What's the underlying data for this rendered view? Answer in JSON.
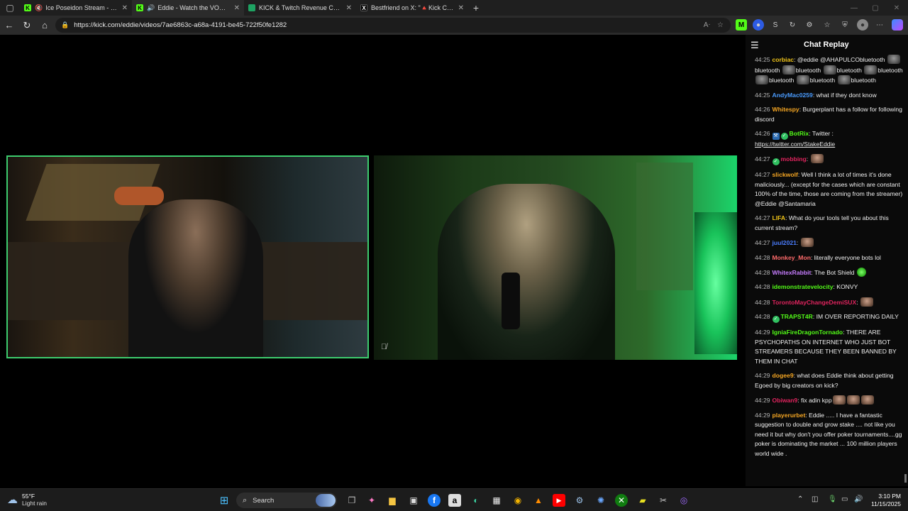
{
  "browser": {
    "tabs": [
      {
        "label": "Ice Poseidon Stream - Watch",
        "favicon": "K",
        "color": "#53fc18",
        "muted": true
      },
      {
        "label": "Eddie - Watch the VOD on K",
        "favicon": "K",
        "color": "#53fc18",
        "audio": true,
        "active": true
      },
      {
        "label": "KICK & Twitch Revenue Calculato",
        "favicon": "",
        "color": "#1ea362"
      },
      {
        "label": "Bestfriend on X: \"🔺Kick CEO Ed",
        "favicon": "X",
        "color": "#000000"
      }
    ],
    "new_tab": "+",
    "url": "https://kick.com/eddie/videos/7ae6863c-a68a-4191-be45-722f50fe1282"
  },
  "chat": {
    "title": "Chat Replay",
    "messages": [
      {
        "ts": "44:25",
        "user": "corbiac",
        "color": "#f0c419",
        "text": "@eddie @AHAPULCO",
        "emote_spam": [
          "bluetooth",
          "bluetooth",
          "bluetooth",
          "bluetooth",
          "bluetooth",
          "bluetooth",
          "bluetooth",
          "bluetooth"
        ]
      },
      {
        "ts": "44:25",
        "user": "AndyMac0259",
        "color": "#4a9cff",
        "text": "what if they dont know"
      },
      {
        "ts": "44:26",
        "user": "Whitespy",
        "color": "#f5a623",
        "text": "Burgerplant has a follow for following discord"
      },
      {
        "ts": "44:26",
        "user": "BotRix",
        "color": "#53fc18",
        "text": "Twitter :",
        "link": "https://twitter.com/StakeEddie"
      },
      {
        "ts": "44:27",
        "user": "mobbing",
        "color": "#e0245e",
        "text": ""
      },
      {
        "ts": "44:27",
        "user": "slickwolf",
        "color": "#f5a623",
        "text": "Well I think a lot of times it's done maliciously... (except for the cases which are constant 100% of the time, those are coming from the streamer) @Eddie @Santamaria"
      },
      {
        "ts": "44:27",
        "user": "LIFA",
        "color": "#f0c419",
        "text": "What do your tools tell you about this current stream?"
      },
      {
        "ts": "44:27",
        "user": "juul2021",
        "color": "#4a7dff",
        "text": ""
      },
      {
        "ts": "44:28",
        "user": "Monkey_Mon",
        "color": "#ff6b6b",
        "text": "literally everyone bots lol"
      },
      {
        "ts": "44:28",
        "user": "WhitexRabbit",
        "color": "#c77dff",
        "text": "The Bot Shield"
      },
      {
        "ts": "44:28",
        "user": "idemonstratevelocity",
        "color": "#53fc18",
        "text": "KONVY"
      },
      {
        "ts": "44:28",
        "user": "TorontoMayChangeDemiSUX",
        "color": "#e0245e",
        "text": ""
      },
      {
        "ts": "44:28",
        "user": "TRAPST4R",
        "color": "#53fc18",
        "text": "IM OVER REPORTING DAILY"
      },
      {
        "ts": "44:29",
        "user": "IgniaFireDragonTornado",
        "color": "#53fc18",
        "text": "THERE ARE PSYCHOPATHS ON INTERNET WHO JUST BOT STREAMERS BECAUSE THEY BEEN BANNED BY THEM IN CHAT"
      },
      {
        "ts": "44:29",
        "user": "dogee9",
        "color": "#f5a623",
        "text": "what does Eddie think about getting Egoed by big creators on kick?"
      },
      {
        "ts": "44:29",
        "user": "Obiwan9",
        "color": "#e0245e",
        "text": "fix adin kpp"
      },
      {
        "ts": "44:29",
        "user": "playerurbet",
        "color": "#f5a623",
        "text": "Eddie ..... I have a fantastic suggestion to double and grow stake .... not like you need it but why don't you offer poker tournaments....gg poker is dominating the market ... 100 million players world wide ."
      }
    ]
  },
  "taskbar": {
    "weather_temp": "55°F",
    "weather_cond": "Light rain",
    "search_label": "Search",
    "time": "3:10 PM",
    "date": "11/15/2025"
  }
}
